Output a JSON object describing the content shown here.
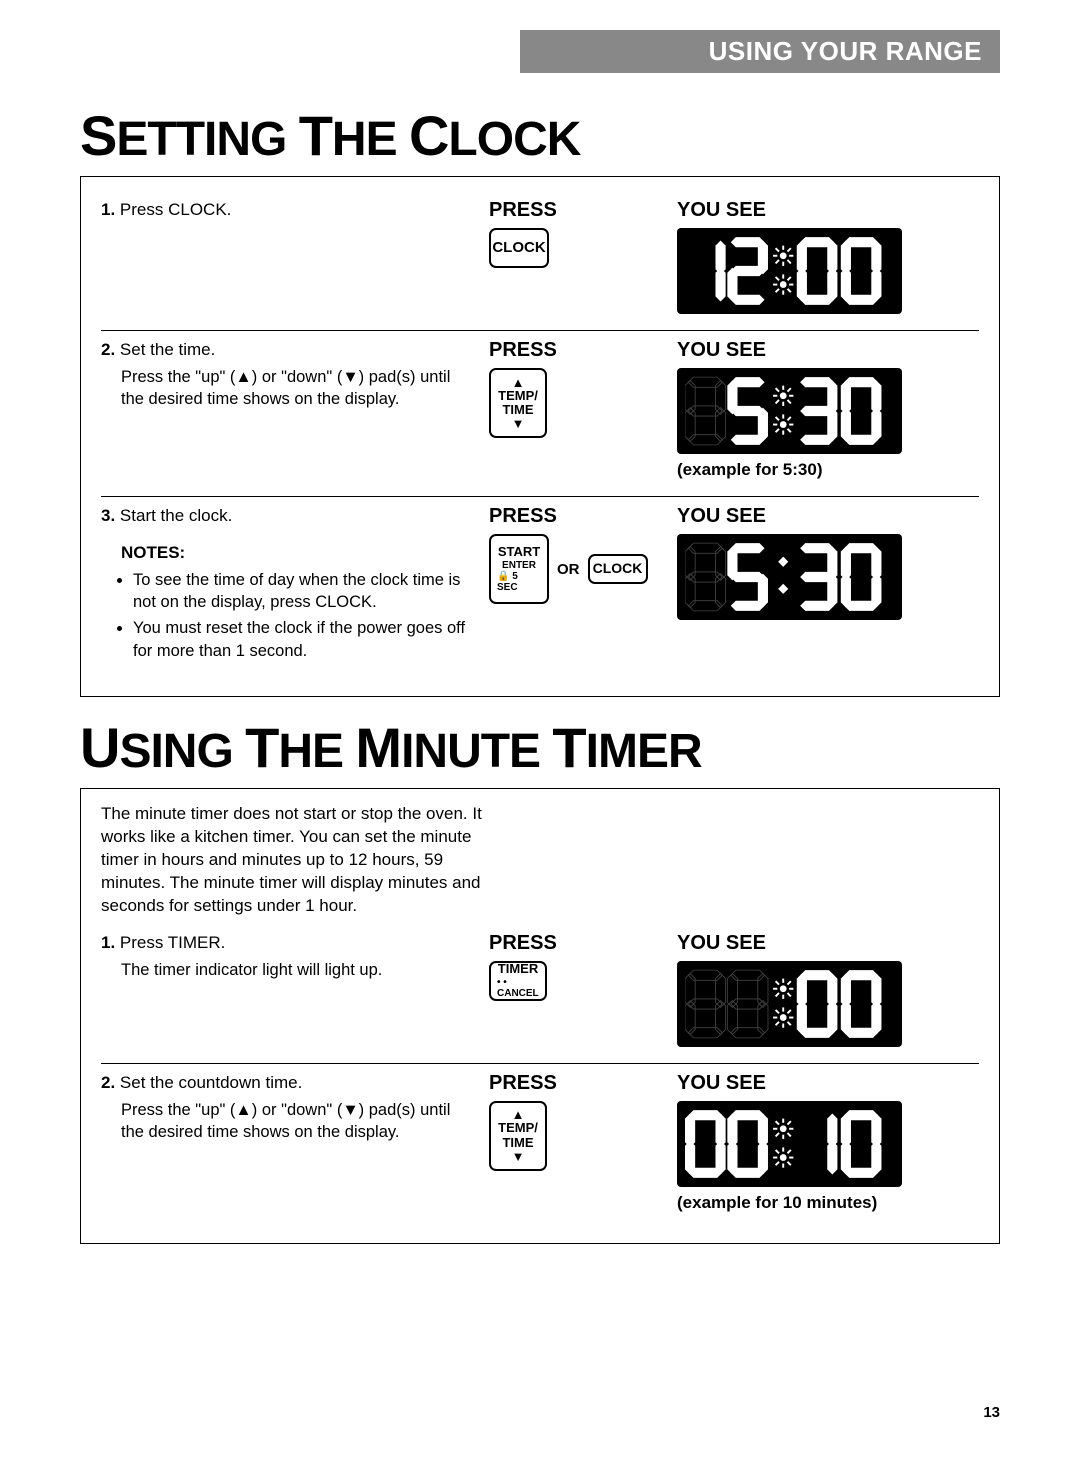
{
  "header": "USING YOUR RANGE",
  "page_number": "13",
  "sec1": {
    "title": {
      "cap1": "S",
      "rest1": "ETTING",
      "cap2": "T",
      "rest2": "HE",
      "cap3": "C",
      "rest3": "LOCK"
    },
    "labels": {
      "press": "PRESS",
      "yousee": "YOU SEE",
      "or": "OR"
    },
    "step1": {
      "num": "1.",
      "text": "Press CLOCK.",
      "key": "CLOCK",
      "display": "12:00"
    },
    "step2": {
      "num": "2.",
      "text": "Set the time.",
      "sub": "Press the \"up\" (▲) or \"down\" (▼) pad(s) until the desired time shows on the display.",
      "key_top": "TEMP/",
      "key_bot": "TIME",
      "display": "5:30",
      "caption": "(example for 5:30)"
    },
    "step3": {
      "num": "3.",
      "text": "Start the clock.",
      "notes_title": "NOTES:",
      "note1": "To see the time of day when the clock time is not on the display, press CLOCK.",
      "note2": "You must reset the clock if the power goes off for more than 1 second.",
      "key1_l1": "START",
      "key1_l2": "ENTER",
      "key1_l3": "🔒 5 SEC",
      "key2": "CLOCK",
      "display": "5:30"
    }
  },
  "sec2": {
    "title": {
      "cap1": "U",
      "rest1": "SING",
      "cap2": "T",
      "rest2": "HE",
      "cap3": "M",
      "rest3": "INUTE",
      "cap4": "T",
      "rest4": "IMER"
    },
    "intro": "The minute timer does not start or stop the oven. It works like a kitchen timer. You can set the minute timer in hours and minutes up to 12 hours, 59 minutes. The minute timer will display minutes and seconds for settings under 1 hour.",
    "labels": {
      "press": "PRESS",
      "yousee": "YOU SEE"
    },
    "step1": {
      "num": "1.",
      "text": "Press TIMER.",
      "sub": "The timer indicator light will light up.",
      "key_l1": "TIMER",
      "key_l2": "• • CANCEL",
      "display": ":00"
    },
    "step2": {
      "num": "2.",
      "text": "Set the countdown time.",
      "sub": "Press the \"up\" (▲) or \"down\" (▼) pad(s) until the desired time shows on the display.",
      "key_top": "TEMP/",
      "key_bot": "TIME",
      "display": "00:10",
      "caption": "(example for 10 minutes)"
    }
  }
}
